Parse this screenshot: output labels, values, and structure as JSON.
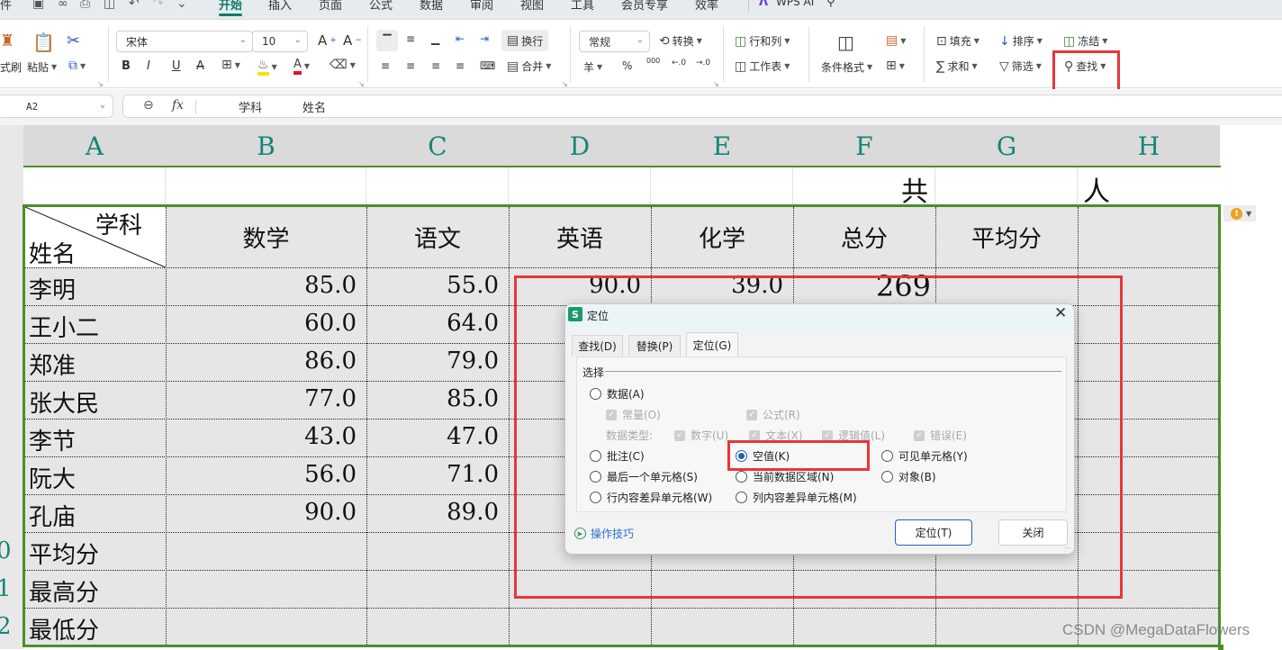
{
  "menubar": {
    "file_partial": "件",
    "tabs": [
      {
        "label": "开始",
        "active": true
      },
      {
        "label": "插入"
      },
      {
        "label": "页面"
      },
      {
        "label": "公式"
      },
      {
        "label": "数据"
      },
      {
        "label": "审阅"
      },
      {
        "label": "视图"
      },
      {
        "label": "工具"
      },
      {
        "label": "会员专享"
      },
      {
        "label": "效率"
      }
    ],
    "wps_ai_label": "WPS AI"
  },
  "ribbon": {
    "format_painter_label": "式刷",
    "paste_label": "粘贴",
    "font_name": "宋体",
    "font_size": "10",
    "wrap_label": "换行",
    "merge_label": "合并",
    "number_format": "常规",
    "convert_label": "转换",
    "rows_cols_label": "行和列",
    "worksheet_label": "工作表",
    "cond_format_label": "条件格式",
    "fill_label": "填充",
    "sort_label": "排序",
    "freeze_label": "冻结",
    "sum_label": "求和",
    "filter_label": "筛选",
    "find_label": "查找",
    "currency_symbol": "羊",
    "percent_symbol": "%",
    "thousands_symbol": "000",
    "highlight_color": "#f5e50a",
    "font_color": "#e8141b"
  },
  "formula_bar": {
    "cell_ref": "A2",
    "fx_label": "fx",
    "content_1": "学科",
    "content_2": "姓名"
  },
  "sheet": {
    "columns": [
      "A",
      "B",
      "C",
      "D",
      "E",
      "F",
      "G",
      "H"
    ],
    "row1": {
      "F": "共",
      "H": "人"
    },
    "header_diag_top": "学科",
    "header_diag_bottom": "姓名",
    "subject_headers": [
      "数学",
      "语文",
      "英语",
      "化学",
      "总分",
      "平均分"
    ],
    "rows": [
      {
        "name": "李明",
        "math": "85.0",
        "chinese": "55.0",
        "english": "90.0",
        "chemistry": "39.0",
        "total": "269"
      },
      {
        "name": "王小二",
        "math": "60.0",
        "chinese": "64.0"
      },
      {
        "name": "郑准",
        "math": "86.0",
        "chinese": "79.0"
      },
      {
        "name": "张大民",
        "math": "77.0",
        "chinese": "85.0"
      },
      {
        "name": "李节",
        "math": "43.0",
        "chinese": "47.0"
      },
      {
        "name": "阮大",
        "math": "56.0",
        "chinese": "71.0"
      },
      {
        "name": "孔庙",
        "math": "90.0",
        "chinese": "89.0"
      }
    ],
    "summary_rows": [
      "平均分",
      "最高分",
      "最低分"
    ],
    "partial_row_numbers": [
      "0",
      "1",
      "2"
    ],
    "accent_border_color": "#4a8f2a",
    "annotation_color": "#e8363b"
  },
  "dialog": {
    "title": "定位",
    "app_icon_letter": "S",
    "tabs": [
      "查找(D)",
      "替换(P)",
      "定位(G)"
    ],
    "active_tab": "定位(G)",
    "group_label": "选择",
    "options": {
      "data": "数据(A)",
      "constants": "常量(O)",
      "formulas": "公式(R)",
      "data_type_label": "数据类型:",
      "numbers": "数字(U)",
      "text": "文本(X)",
      "logicals": "逻辑值(L)",
      "errors": "错误(E)",
      "comments": "批注(C)",
      "blanks": "空值(K)",
      "visible_cells": "可见单元格(Y)",
      "last_cell": "最后一个单元格(S)",
      "current_region": "当前数据区域(N)",
      "objects": "对象(B)",
      "row_diff": "行内容差异单元格(W)",
      "col_diff": "列内容差异单元格(M)"
    },
    "selected_option": "空值(K)",
    "tips_link": "操作技巧",
    "goto_button": "定位(T)",
    "close_button": "关闭"
  },
  "watermark": "CSDN @MegaDataFlowers"
}
